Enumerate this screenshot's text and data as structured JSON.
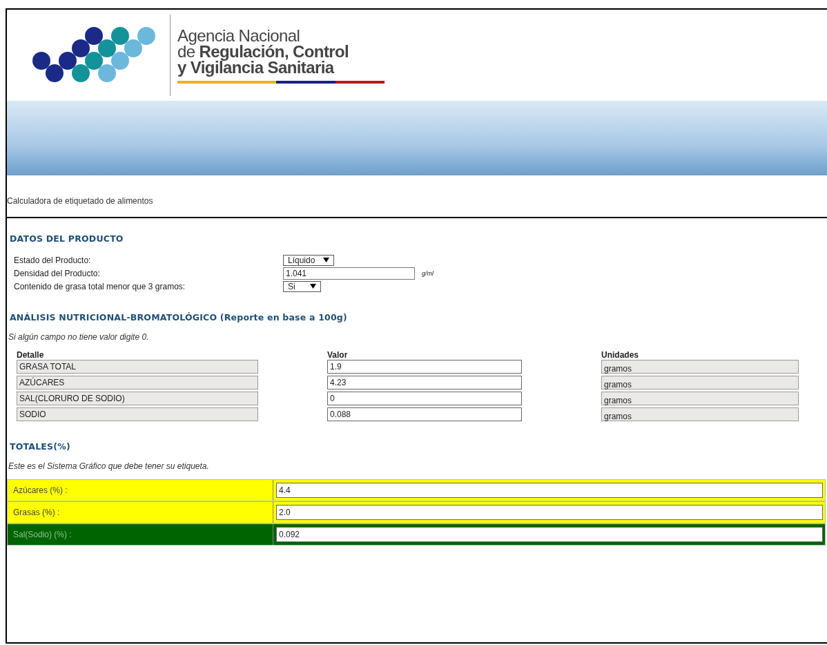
{
  "header": {
    "logo_lines": [
      {
        "text": "Agencia Nacional",
        "bold": false
      },
      {
        "text": "de **Regulación, Control**",
        "bold": false
      },
      {
        "text": "y Vigilancia Sanitaria",
        "bold": true
      }
    ]
  },
  "page_title": "Calculadora de etiquetado de alimentos",
  "product_section": {
    "title": "DATOS DEL PRODUCTO",
    "fields": [
      {
        "kind": "select",
        "label": "Estado del Producto:",
        "value": "Líquido"
      },
      {
        "kind": "input",
        "label": "Densidad del Producto:",
        "value": "1.041",
        "unit": "g/ml"
      },
      {
        "kind": "select",
        "label": "Contenido de grasa total menor que 3 gramos:",
        "value": "Si"
      }
    ]
  },
  "analysis_section": {
    "title": "ANÁLISIS NUTRICIONAL-BROMATOLÓGICO (Reporte en base a 100g)",
    "note": "Si algún campo no tiene valor digite 0.",
    "columns": [
      "Detalle",
      "Valor",
      "Unidades"
    ],
    "rows": [
      {
        "detail": "GRASA TOTAL",
        "value": "1.9",
        "unit": "gramos"
      },
      {
        "detail": "AZÚCARES",
        "value": "4.23",
        "unit": "gramos"
      },
      {
        "detail": "SAL(CLORURO DE SODIO)",
        "value": "0",
        "unit": "gramos"
      },
      {
        "detail": "SODIO",
        "value": "0.088",
        "unit": "gramos"
      }
    ]
  },
  "totals_section": {
    "title": "TOTALES(%)",
    "note": "Este es el Sistema Gráfico que debe tener su etiqueta.",
    "rows": [
      {
        "label": "Azúcares (%) :",
        "value": "4.4",
        "color": "#ffff00"
      },
      {
        "label": "Grasas (%) :",
        "value": "2.0",
        "color": "#ffff00"
      },
      {
        "label": "Sal(Sodio) (%) :",
        "value": "0.092",
        "color": "#006400"
      }
    ]
  }
}
